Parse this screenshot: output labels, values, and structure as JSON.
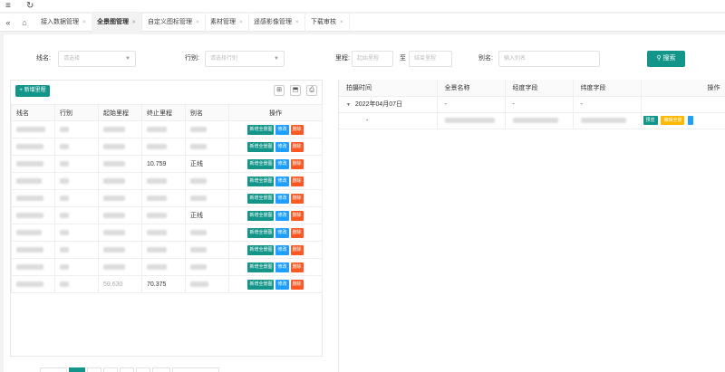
{
  "topbar": {
    "menu_icon": "≡",
    "refresh_icon": "↻"
  },
  "tabs": {
    "back_icon": "«",
    "home_icon": "⌂",
    "items": [
      {
        "label": "接入数据管理"
      },
      {
        "label": "全景图管理"
      },
      {
        "label": "自定义图标管理"
      },
      {
        "label": "素材管理"
      },
      {
        "label": "遥感影像管理"
      },
      {
        "label": "下载审核"
      }
    ],
    "close": "×"
  },
  "filters": {
    "line_label": "线名:",
    "line_placeholder": "请选择",
    "row_label": "行别:",
    "row_placeholder": "请选择行别",
    "mileage_label": "里程:",
    "start_placeholder": "起始里程",
    "to_label": "至",
    "end_placeholder": "结束里程",
    "alias_label": "别名:",
    "alias_placeholder": "输入别名",
    "search_button": "搜索",
    "search_icon": "⚲"
  },
  "left_table": {
    "add_button": "+ 新增里程",
    "tool_icons": [
      "⊞",
      "⬒",
      "⎙"
    ],
    "columns": [
      "线名",
      "行别",
      "起始里程",
      "终止里程",
      "别名",
      "操作"
    ],
    "rows": [
      {
        "end": "",
        "alias": ""
      },
      {
        "end": "",
        "alias": ""
      },
      {
        "end": "10.759",
        "alias": "正线"
      },
      {
        "end": "",
        "alias": ""
      },
      {
        "end": "",
        "alias": ""
      },
      {
        "end": "",
        "alias": "正线"
      },
      {
        "end": "",
        "alias": ""
      },
      {
        "end": "",
        "alias": ""
      },
      {
        "end": "",
        "alias": ""
      },
      {
        "end": "70.375",
        "alias": ""
      }
    ],
    "row_start_partial": {
      "row_index": 9,
      "value": "59.630"
    },
    "buttons": {
      "new": "新增全景图",
      "edit": "修改",
      "del": "删除"
    }
  },
  "right_table": {
    "columns": [
      "拍摄时间",
      "全景名称",
      "经度字段",
      "纬度字段",
      "操作"
    ],
    "group_row": {
      "arrow": "▼",
      "date": "2022年04月07日",
      "name": "-",
      "lng": "-",
      "lat": "-"
    },
    "detail_row": {
      "time": "-",
      "name": "",
      "lng": "",
      "lat": ""
    },
    "buttons": {
      "preview": "预览",
      "edit_info": "编辑全景"
    }
  },
  "colors": {
    "primary": "#13958a",
    "edit": "#1e9fff",
    "danger": "#ff5722",
    "warn": "#ffb800"
  }
}
